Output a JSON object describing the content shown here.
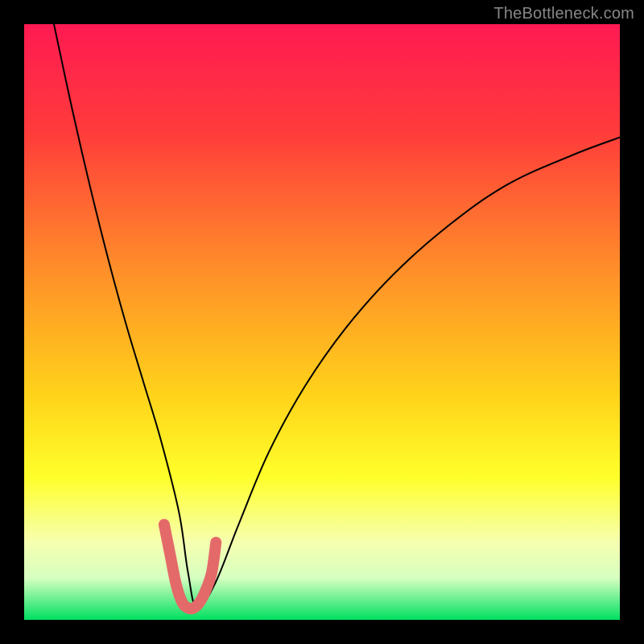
{
  "watermark": "TheBottleneck.com",
  "chart_data": {
    "type": "line",
    "title": "",
    "xlabel": "",
    "ylabel": "",
    "xlim": [
      0,
      100
    ],
    "ylim": [
      0,
      100
    ],
    "gradient_stops": [
      {
        "offset": 0,
        "color": "#ff1a52"
      },
      {
        "offset": 18,
        "color": "#ff3b3b"
      },
      {
        "offset": 40,
        "color": "#ff8a2a"
      },
      {
        "offset": 62,
        "color": "#ffd21a"
      },
      {
        "offset": 76,
        "color": "#ffff2a"
      },
      {
        "offset": 87,
        "color": "#f6ffb0"
      },
      {
        "offset": 93,
        "color": "#d6ffc0"
      },
      {
        "offset": 100,
        "color": "#00e060"
      }
    ],
    "series": [
      {
        "name": "bottleneck-curve",
        "x": [
          5,
          8,
          11,
          14,
          17,
          20,
          23,
          26,
          27.5,
          29,
          32,
          36,
          41,
          47,
          54,
          62,
          71,
          81,
          92,
          100
        ],
        "y": [
          100,
          86,
          73,
          61,
          50,
          40,
          30,
          18,
          8,
          2,
          6,
          16,
          28,
          39,
          49,
          58,
          66,
          73,
          78,
          81
        ],
        "stroke": "#000000",
        "stroke_width": 2
      },
      {
        "name": "highlight-segment",
        "x": [
          23.5,
          24.5,
          25.5,
          26.5,
          27.5,
          28.5,
          29.5,
          30.5,
          31.5,
          32.2
        ],
        "y": [
          16,
          11,
          6,
          3,
          2,
          2,
          3,
          5,
          8,
          13
        ],
        "stroke": "#e46a6a",
        "stroke_width": 14
      }
    ]
  }
}
